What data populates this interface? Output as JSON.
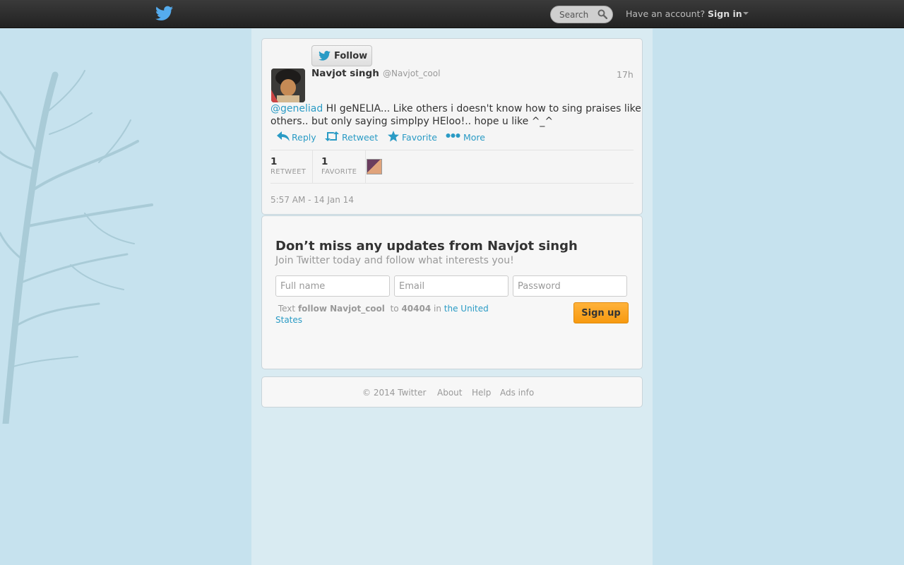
{
  "topbar": {
    "search_label": "Search",
    "have_account": "Have an account?",
    "sign_in": "Sign in"
  },
  "tweet": {
    "follow_label": "Follow",
    "name": "Navjot singh",
    "handle": "@Navjot_cool",
    "time_ago": "17h",
    "mention": "@geneliad",
    "text": " HI geNELIA... Like others i doesn't know how to sing praises like others.. but only saying simplpy HEloo!.. hope u like ^_^",
    "actions": {
      "reply": "Reply",
      "retweet": "Retweet",
      "favorite": "Favorite",
      "more": "More"
    },
    "stats": {
      "retweets_count": "1",
      "retweets_label": "RETWEET",
      "favorites_count": "1",
      "favorites_label": "FAVORITE"
    },
    "timestamp": "5:57 AM - 14 Jan 14"
  },
  "signup": {
    "title": "Don’t miss any updates from Navjot singh",
    "subtitle": "Join Twitter today and follow what interests you!",
    "fullname_placeholder": "Full name",
    "email_placeholder": "Email",
    "password_placeholder": "Password",
    "sms_text": "Text",
    "sms_command": "follow Navjot_cool",
    "sms_to": "to",
    "sms_number": "40404",
    "sms_in": "in",
    "sms_country": "the United States",
    "button": "Sign up"
  },
  "footer": {
    "copyright": "© 2014 Twitter",
    "about": "About",
    "help": "Help",
    "ads_info": "Ads info"
  },
  "colors": {
    "accent_link": "#2a9bc5",
    "signup_button": "#f79a10",
    "background": "#c6e2ee"
  }
}
